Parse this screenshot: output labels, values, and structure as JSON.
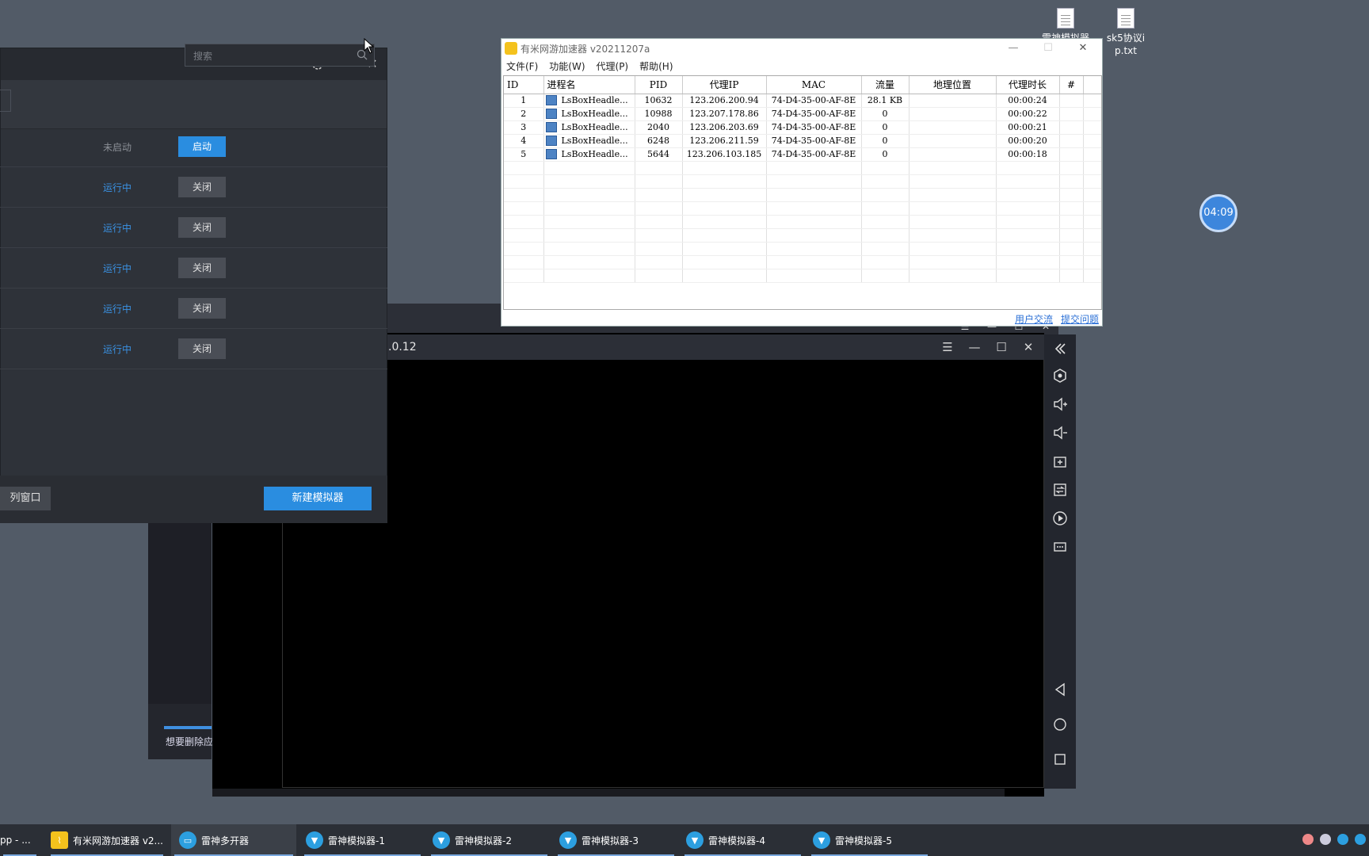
{
  "desktop": {
    "icons": [
      {
        "label": "雷神模拟器"
      },
      {
        "label": "sk5协议ip.txt"
      }
    ],
    "clock": "04:09"
  },
  "manager": {
    "search_placeholder": "搜索",
    "rows": [
      {
        "status": "未启动",
        "action": "启动"
      },
      {
        "status": "运行中",
        "action": "关闭"
      },
      {
        "status": "运行中",
        "action": "关闭"
      },
      {
        "status": "运行中",
        "action": "关闭"
      },
      {
        "status": "运行中",
        "action": "关闭"
      },
      {
        "status": "运行中",
        "action": "关闭"
      }
    ],
    "arrange_label": "列窗口",
    "new_label": "新建模拟器",
    "hint_text": "想要删除应"
  },
  "emulator": {
    "title": ".0.12"
  },
  "accelerator": {
    "title": "有米网游加速器 v20211207a",
    "menu": [
      "文件(F)",
      "功能(W)",
      "代理(P)",
      "帮助(H)"
    ],
    "columns": [
      "ID",
      "进程名",
      "PID",
      "代理IP",
      "MAC",
      "流量",
      "地理位置",
      "代理时长",
      "#"
    ],
    "rows": [
      {
        "id": "1",
        "proc": "LsBoxHeadle...",
        "pid": "10632",
        "ip": "123.206.200.94",
        "mac": "74-D4-35-00-AF-8E",
        "traffic": "28.1 KB",
        "geo": "",
        "dur": "00:00:24"
      },
      {
        "id": "2",
        "proc": "LsBoxHeadle...",
        "pid": "10988",
        "ip": "123.207.178.86",
        "mac": "74-D4-35-00-AF-8E",
        "traffic": "0",
        "geo": "",
        "dur": "00:00:22"
      },
      {
        "id": "3",
        "proc": "LsBoxHeadle...",
        "pid": "2040",
        "ip": "123.206.203.69",
        "mac": "74-D4-35-00-AF-8E",
        "traffic": "0",
        "geo": "",
        "dur": "00:00:21"
      },
      {
        "id": "4",
        "proc": "LsBoxHeadle...",
        "pid": "6248",
        "ip": "123.206.211.59",
        "mac": "74-D4-35-00-AF-8E",
        "traffic": "0",
        "geo": "",
        "dur": "00:00:20"
      },
      {
        "id": "5",
        "proc": "LsBoxHeadle...",
        "pid": "5644",
        "ip": "123.206.103.185",
        "mac": "74-D4-35-00-AF-8E",
        "traffic": "0",
        "geo": "",
        "dur": "00:00:18"
      }
    ],
    "links": [
      "用户交流",
      "提交问题"
    ]
  },
  "taskbar": {
    "items": [
      {
        "label": "pp - ..."
      },
      {
        "label": "有米网游加速器 v2..."
      },
      {
        "label": "雷神多开器"
      },
      {
        "label": "雷神模拟器-1"
      },
      {
        "label": "雷神模拟器-2"
      },
      {
        "label": "雷神模拟器-3"
      },
      {
        "label": "雷神模拟器-4"
      },
      {
        "label": "雷神模拟器-5"
      }
    ]
  }
}
